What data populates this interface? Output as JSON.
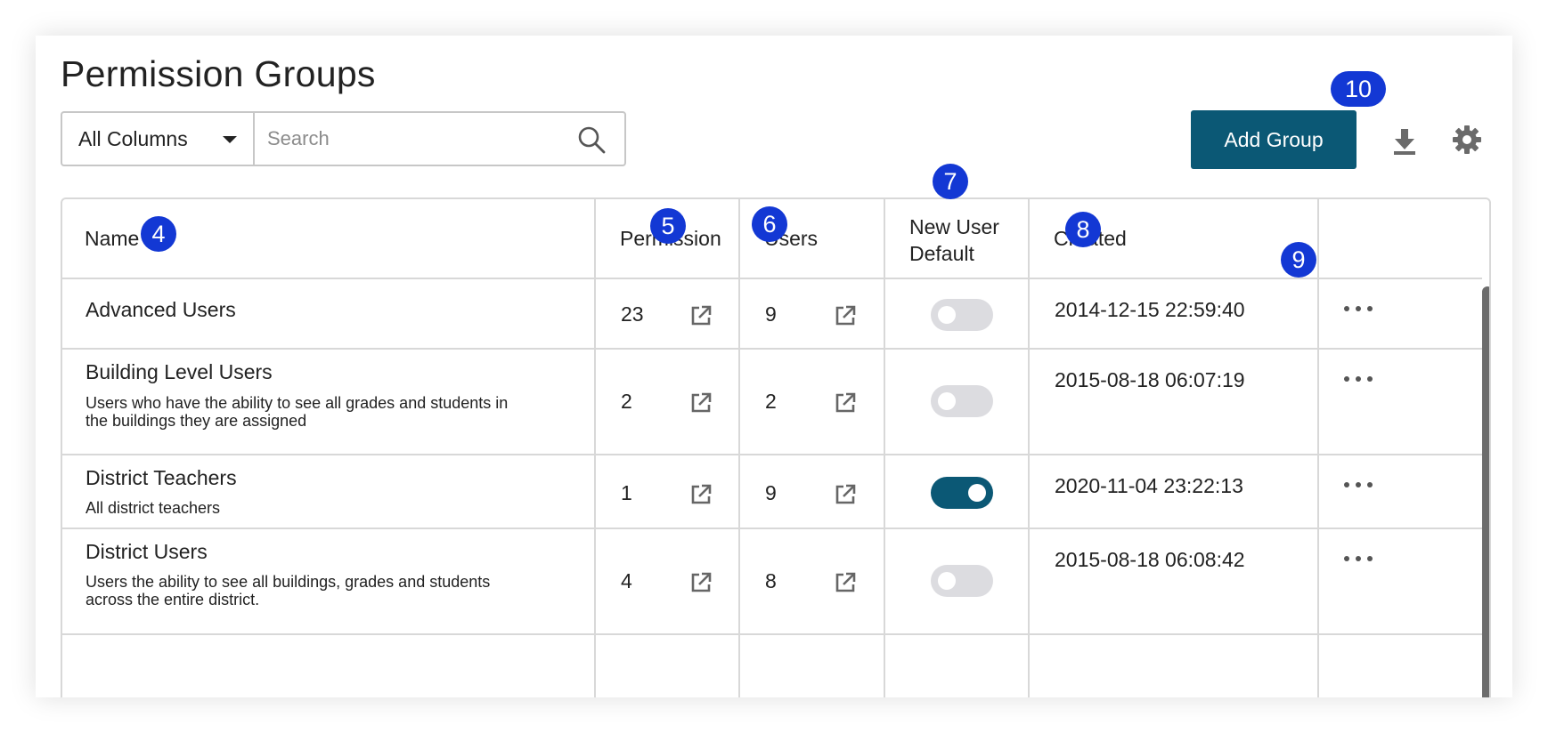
{
  "page": {
    "title": "Permission Groups"
  },
  "filter": {
    "column_select": "All Columns",
    "search_placeholder": "Search"
  },
  "toolbar": {
    "add_label": "Add Group",
    "download_icon": "download-icon",
    "settings_icon": "gear-icon"
  },
  "table": {
    "headers": {
      "name": "Name",
      "permission": "Permission",
      "users": "Users",
      "new_user_default_line1": "New User",
      "new_user_default_line2": "Default",
      "created": "Created"
    },
    "rows": [
      {
        "name": "Advanced Users",
        "description_line1": "",
        "description_line2": "",
        "permission": "23",
        "users": "9",
        "new_user_default": false,
        "created": "2014-12-15 22:59:40"
      },
      {
        "name": "Building Level Users",
        "description_line1": "Users who have the ability to see all grades and students in",
        "description_line2": "the buildings they are assigned",
        "permission": "2",
        "users": "2",
        "new_user_default": false,
        "created": "2015-08-18 06:07:19"
      },
      {
        "name": "District Teachers",
        "description_line1": "All district teachers",
        "description_line2": "",
        "permission": "1",
        "users": "9",
        "new_user_default": true,
        "created": "2020-11-04 23:22:13"
      },
      {
        "name": "District Users",
        "description_line1": "Users the ability to see all buildings, grades and students",
        "description_line2": "across the entire district.",
        "permission": "4",
        "users": "8",
        "new_user_default": false,
        "created": "2015-08-18 06:08:42"
      }
    ]
  },
  "badges": {
    "name": "4",
    "permission": "5",
    "users": "6",
    "new_user_default": "7",
    "created": "8",
    "row_actions": "9",
    "add_group": "10"
  },
  "colors": {
    "primary": "#0b5875",
    "badge": "#1338d4",
    "toggle_off": "#dcdce0",
    "border": "#d8d8d8"
  }
}
